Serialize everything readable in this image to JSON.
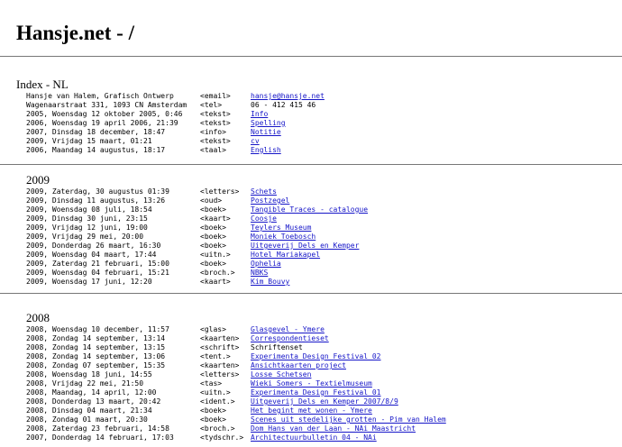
{
  "site": {
    "title": "Hansje.net - /"
  },
  "index": {
    "title": "Index - NL",
    "entries": [
      {
        "date": "Hansje van Halem, Grafisch Ontwerp",
        "type": "<email>",
        "value": "hansje@hansje.net",
        "link": true
      },
      {
        "date": "Wagenaarstraat 331, 1093 CN Amsterdam",
        "type": "<tel>",
        "value": "06 - 412 415 46",
        "link": false
      },
      {
        "date": "2005, Woensdag 12 oktober 2005, 0:46",
        "type": "<tekst>",
        "value": "Info",
        "link": true
      },
      {
        "date": "2006, Woensdag 19 april 2006, 21:39",
        "type": "<tekst>",
        "value": "Spelling",
        "link": true
      },
      {
        "date": "2007, Dinsdag 18 december, 18:47",
        "type": "<info>",
        "value": "Notitie",
        "link": true
      },
      {
        "date": "2009, Vrijdag 15 maart, 01:21",
        "type": "<tekst>",
        "value": "cv",
        "link": true
      },
      {
        "date": "2006, Maandag 14 augustus, 18:17",
        "type": "<taal>",
        "value": "English",
        "link": true
      }
    ]
  },
  "years": [
    {
      "title": "2009",
      "entries": [
        {
          "date": "2009, Zaterdag, 30 augustus 01:39",
          "type": "<letters>",
          "value": "Schets",
          "link": true
        },
        {
          "date": "2009, Dinsdag 11 augustus, 13:26",
          "type": "<oud>",
          "value": "Postzegel",
          "link": true
        },
        {
          "date": "2009, Woensdag 08 juli, 18:54",
          "type": "<boek>",
          "value": "Tangible Traces - catalogue",
          "link": true
        },
        {
          "date": "2009, Dinsdag 30 juni, 23:15",
          "type": "<kaart>",
          "value": "Coosje",
          "link": true
        },
        {
          "date": "2009, Vrijdag 12 juni, 19:00",
          "type": "<boek>",
          "value": "Teylers Museum",
          "link": true
        },
        {
          "date": "2009, Vrijdag 29 mei, 20:00",
          "type": "<boek>",
          "value": "Moniek Toebosch",
          "link": true
        },
        {
          "date": "2009, Donderdag 26 maart, 16:30",
          "type": "<boek>",
          "value": "Uitgeverij Dels en Kemper",
          "link": true
        },
        {
          "date": "2009, Woensdag 04 maart, 17:44",
          "type": "<uitn.>",
          "value": "Hotel Mariakapel",
          "link": true
        },
        {
          "date": "2009, Zaterdag 21 februari, 15:00",
          "type": "<boek>",
          "value": "Ophelia",
          "link": true
        },
        {
          "date": "2009, Woensdag 04 februari, 15:21",
          "type": "<broch.>",
          "value": "NBKS",
          "link": true
        },
        {
          "date": "2009, Woensdag 17 juni, 12:20",
          "type": "<kaart>",
          "value": "Kim Bouvy",
          "link": true
        }
      ]
    },
    {
      "title": "2008",
      "entries": [
        {
          "date": "2008, Woensdag 10 december, 11:57",
          "type": "<glas>",
          "value": "Glasgevel - Ymere",
          "link": true
        },
        {
          "date": "2008, Zondag 14 september, 13:14",
          "type": "<kaarten>",
          "value": "Correspondentieset",
          "link": true
        },
        {
          "date": "2008, Zondag 14 september, 13:15",
          "type": "<schrift>",
          "value": "Schriftenset",
          "link": false
        },
        {
          "date": "2008, Zondag 14 september, 13:06",
          "type": "<tent.>",
          "value": "Experimenta Design Festival 02",
          "link": true
        },
        {
          "date": "2008, Zondag 07 september, 15:35",
          "type": "<kaarten>",
          "value": "Ansichtkaarten project",
          "link": true
        },
        {
          "date": "2008, Woensdag 18 juni, 14:55",
          "type": "<letters>",
          "value": "Losse Schetsen",
          "link": true
        },
        {
          "date": "2008, Vrijdag 22 mei, 21:50",
          "type": "<tas>",
          "value": "Wieki Somers - Textielmuseum",
          "link": true
        },
        {
          "date": "2008, Maandag, 14 april, 12:00",
          "type": "<uitn.>",
          "value": "Experimenta Design Festival 01",
          "link": true
        },
        {
          "date": "2008, Donderdag 13 maart, 20:42",
          "type": "<ident.>",
          "value": "Uitgeverij Dels en Kemper 2007/8/9",
          "link": true
        },
        {
          "date": "2008, Dinsdag 04 maart, 21:34",
          "type": "<boek>",
          "value": "Het begint met wonen - Ymere",
          "link": true
        },
        {
          "date": "2008, Zondag 01 maart, 20:30",
          "type": "<boek>",
          "value": "Scenes uit stedelijke grotten - Pim van Halem",
          "link": true
        },
        {
          "date": "2008, Zaterdag 23 februari, 14:58",
          "type": "<broch.>",
          "value": "Dom Hans van der Laan - NAi Maastricht",
          "link": true
        },
        {
          "date": "2007, Donderdag 14 februari, 17:03",
          "type": "<tydschr.>",
          "value": "Architectuurbulletin 04 - NAi",
          "link": true
        }
      ]
    }
  ]
}
